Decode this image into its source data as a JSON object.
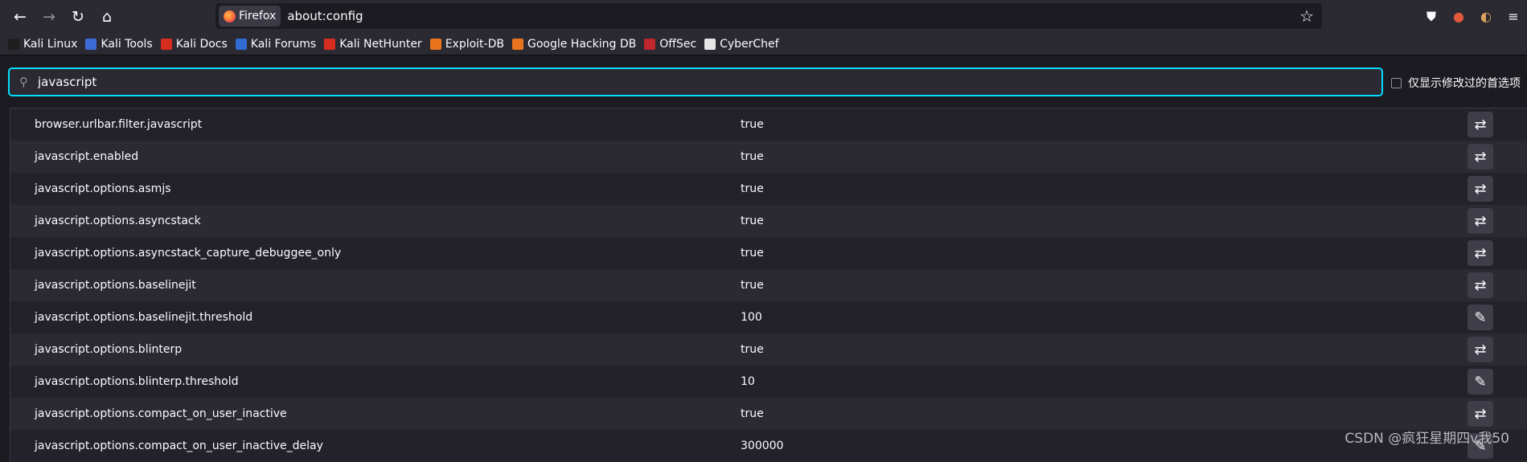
{
  "toolbar": {
    "back_icon": "←",
    "forward_icon": "→",
    "reload_icon": "↻",
    "home_icon": "⌂",
    "identity_label": "Firefox",
    "url": "about:config",
    "star_icon": "☆",
    "pocket_icon": "⛊",
    "extension_icon": "●",
    "profile_icon": "◐",
    "menu_icon": "≡"
  },
  "bookmarks": [
    {
      "label": "Kali Linux",
      "color": "#1e1e1e"
    },
    {
      "label": "Kali Tools",
      "color": "#3d6bd6"
    },
    {
      "label": "Kali Docs",
      "color": "#d62d20"
    },
    {
      "label": "Kali Forums",
      "color": "#2f6bd1"
    },
    {
      "label": "Kali NetHunter",
      "color": "#d62d20"
    },
    {
      "label": "Exploit-DB",
      "color": "#e8741e"
    },
    {
      "label": "Google Hacking DB",
      "color": "#e8741e"
    },
    {
      "label": "OffSec",
      "color": "#c0262d"
    },
    {
      "label": "CyberChef",
      "color": "#e6e6e6"
    }
  ],
  "search": {
    "value": "javascript",
    "icon": "⚲"
  },
  "modified_only": {
    "label": "仅显示修改过的首选项",
    "checked": false
  },
  "preferences": [
    {
      "name": "browser.urlbar.filter.javascript",
      "value": "true",
      "action": "toggle"
    },
    {
      "name": "javascript.enabled",
      "value": "true",
      "action": "toggle"
    },
    {
      "name": "javascript.options.asmjs",
      "value": "true",
      "action": "toggle"
    },
    {
      "name": "javascript.options.asyncstack",
      "value": "true",
      "action": "toggle"
    },
    {
      "name": "javascript.options.asyncstack_capture_debuggee_only",
      "value": "true",
      "action": "toggle"
    },
    {
      "name": "javascript.options.baselinejit",
      "value": "true",
      "action": "toggle"
    },
    {
      "name": "javascript.options.baselinejit.threshold",
      "value": "100",
      "action": "edit"
    },
    {
      "name": "javascript.options.blinterp",
      "value": "true",
      "action": "toggle"
    },
    {
      "name": "javascript.options.blinterp.threshold",
      "value": "10",
      "action": "edit"
    },
    {
      "name": "javascript.options.compact_on_user_inactive",
      "value": "true",
      "action": "toggle"
    },
    {
      "name": "javascript.options.compact_on_user_inactive_delay",
      "value": "300000",
      "action": "edit"
    }
  ],
  "action_icons": {
    "toggle": "⇄",
    "edit": "✎"
  },
  "watermark": "CSDN @疯狂星期四v我50"
}
